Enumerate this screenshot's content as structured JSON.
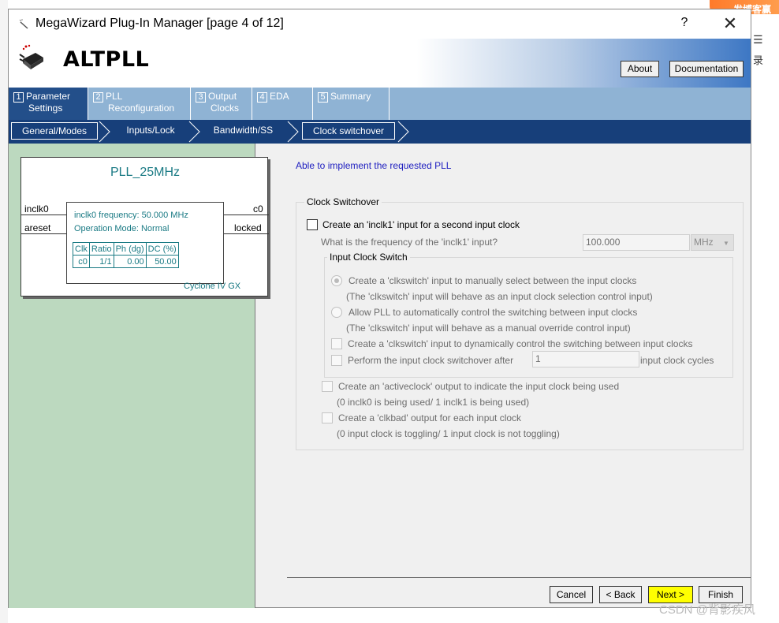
{
  "window": {
    "title": "MegaWizard Plug-In Manager [page 4 of 12]",
    "help": "?",
    "close": "✕"
  },
  "background": {
    "badge_text": "发博客赢",
    "side_icon": "☰",
    "side_text": "录"
  },
  "header": {
    "logo_text": "ALTPLL",
    "about_label": "About",
    "documentation_label": "Documentation"
  },
  "tabs": [
    {
      "num": "1",
      "line1": "Parameter",
      "line2": "Settings"
    },
    {
      "num": "2",
      "line1": "PLL",
      "line2": "Reconfiguration"
    },
    {
      "num": "3",
      "line1": "Output",
      "line2": "Clocks"
    },
    {
      "num": "4",
      "line1": "EDA",
      "line2": ""
    },
    {
      "num": "5",
      "line1": "Summary",
      "line2": ""
    }
  ],
  "subtabs": [
    "General/Modes",
    "Inputs/Lock",
    "Bandwidth/SS",
    "Clock switchover"
  ],
  "pll_diagram": {
    "name": "PLL_25MHz",
    "pin_inclk0": "inclk0",
    "pin_areset": "areset",
    "pin_c0": "c0",
    "pin_locked": "locked",
    "freq_text": "inclk0 frequency: 50.000 MHz",
    "mode_text": "Operation Mode: Normal",
    "table_headers": [
      "Clk",
      "Ratio",
      "Ph (dg)",
      "DC (%)"
    ],
    "table_row": [
      "c0",
      "1/1",
      "0.00",
      "50.00"
    ],
    "device": "Cyclone IV GX"
  },
  "content": {
    "status": "Able to implement the requested PLL",
    "group_title": "Clock Switchover",
    "create_inclk1": "Create an 'inclk1' input for a second input clock",
    "freq_question": "What is the frequency of the 'inclk1' input?",
    "freq_value": "100.000",
    "freq_unit": "MHz",
    "ics_title": "Input Clock Switch",
    "radio_manual": "Create a 'clkswitch' input to manually select between the input clocks",
    "radio_manual_note": "(The 'clkswitch' input will behave as an input clock selection control input)",
    "radio_auto": "Allow PLL to automatically control the switching between input clocks",
    "radio_auto_note": "(The 'clkswitch' input will behave as a manual override control input)",
    "cb_dynamic": "Create a 'clkswitch' input to dynamically control the switching between input clocks",
    "cb_after": "Perform the input clock switchover after",
    "cycles_value": "1",
    "cycles_suffix": "input clock cycles",
    "cb_activeclock": "Create an 'activeclock' output to indicate the input clock being used",
    "activeclock_note": "(0 inclk0 is being used/ 1 inclk1 is being used)",
    "cb_clkbad": "Create a 'clkbad' output for each input clock",
    "clkbad_note": "(0 input clock is toggling/ 1 input clock is not toggling)"
  },
  "footer": {
    "cancel": "Cancel",
    "back": "< Back",
    "next": "Next >",
    "finish": "Finish",
    "watermark": "CSDN @背影疾风"
  }
}
